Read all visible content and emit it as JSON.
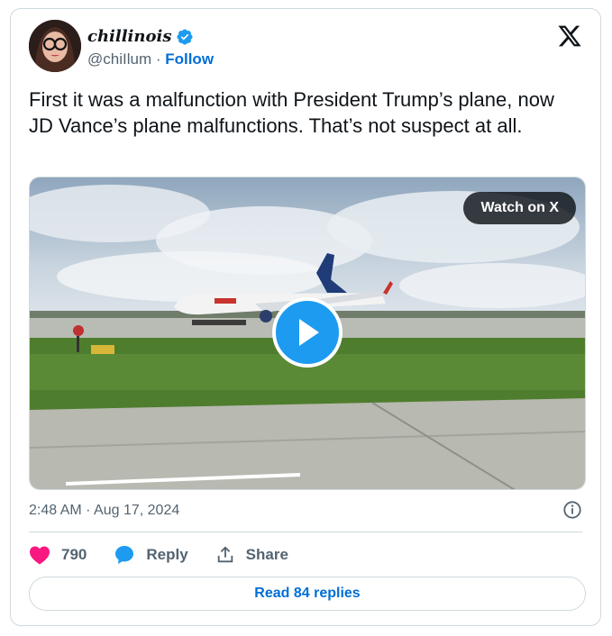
{
  "author": {
    "display_name": "chillinois",
    "handle": "@chiIlum",
    "separator": " · ",
    "follow_label": "Follow",
    "verified_color": "#1d9bf0"
  },
  "tweet": {
    "text": "First it was a malfunction with President Trump’s plane, now JD Vance’s plane malfunctions. That’s not suspect at all.",
    "timestamp": "2:48 AM · Aug 17, 2024"
  },
  "media": {
    "watch_label": "Watch on X",
    "play_icon": "play-icon"
  },
  "actions": {
    "like_count": "790",
    "reply_label": "Reply",
    "share_label": "Share"
  },
  "footer": {
    "read_replies_label": "Read 84 replies"
  },
  "colors": {
    "link": "#006fd6",
    "like": "#f91880",
    "reply": "#1d9bf0",
    "muted": "#536471"
  }
}
